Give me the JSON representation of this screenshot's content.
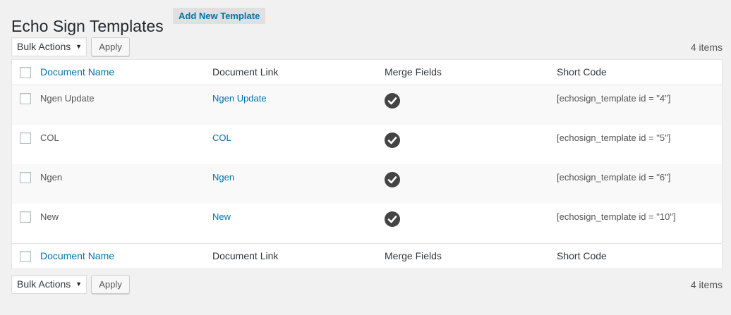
{
  "page": {
    "title": "Echo Sign Templates",
    "add_new_label": "Add New Template"
  },
  "tablenav": {
    "bulk_actions": "Bulk Actions",
    "apply_label": "Apply",
    "items_count": "4 items"
  },
  "table": {
    "columns": [
      "Document Name",
      "Document Link",
      "Merge Fields",
      "Short Code"
    ],
    "rows": [
      {
        "name": "Ngen Update",
        "link": "Ngen Update",
        "merge_icon": "check-circle-icon",
        "shortcode": "[echosign_template id = \"4\"]"
      },
      {
        "name": "COL",
        "link": "COL",
        "merge_icon": "check-circle-icon",
        "shortcode": "[echosign_template id = \"5\"]"
      },
      {
        "name": "Ngen",
        "link": "Ngen",
        "merge_icon": "check-circle-icon",
        "shortcode": "[echosign_template id = \"6\"]"
      },
      {
        "name": "New",
        "link": "New",
        "merge_icon": "check-circle-icon",
        "shortcode": "[echosign_template id = \"10\"]"
      }
    ]
  },
  "colors": {
    "link": "#0073aa",
    "icon": "#444444",
    "background": "#f1f1f1"
  }
}
